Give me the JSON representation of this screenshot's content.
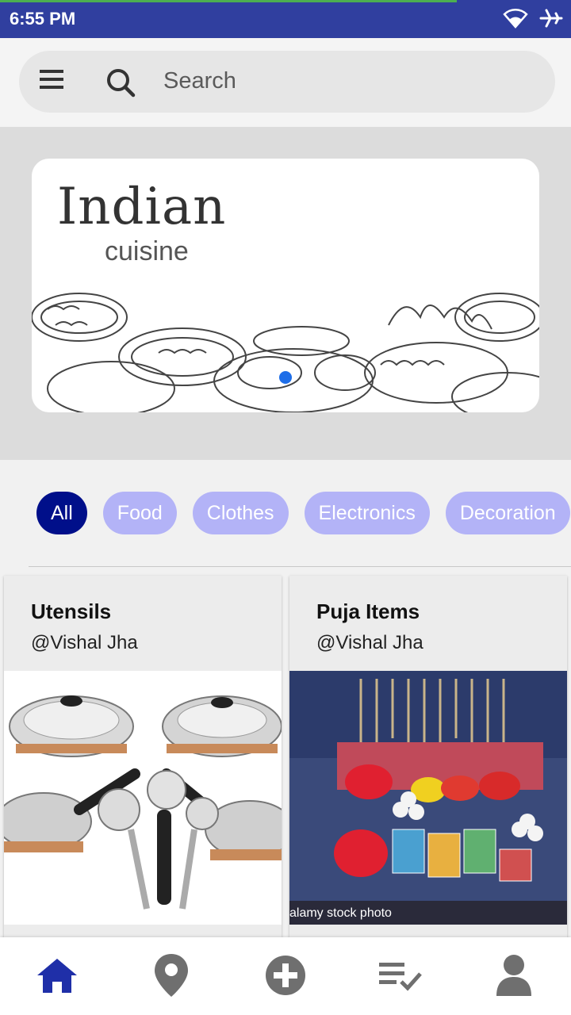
{
  "status_bar": {
    "time": "6:55 PM",
    "icons": [
      "wifi-icon",
      "airplane-icon"
    ],
    "color": "#303f9f"
  },
  "search": {
    "placeholder": "Search"
  },
  "banner": {
    "title": "Indian",
    "subtitle": "cuisine",
    "slide_count": 1,
    "active_slide": 1
  },
  "chips": [
    {
      "label": "All",
      "active": true
    },
    {
      "label": "Food",
      "active": false
    },
    {
      "label": "Clothes",
      "active": false
    },
    {
      "label": "Electronics",
      "active": false
    },
    {
      "label": "Decoration",
      "active": false
    }
  ],
  "cards": [
    {
      "title": "Utensils",
      "author": "@Vishal Jha"
    },
    {
      "title": "Puja Items",
      "author": "@Vishal Jha",
      "image_caption": "alamy stock photo"
    }
  ],
  "bottom_nav": [
    {
      "icon": "home-icon",
      "active": true
    },
    {
      "icon": "location-pin-icon",
      "active": false
    },
    {
      "icon": "add-circle-icon",
      "active": false
    },
    {
      "icon": "checklist-icon",
      "active": false
    },
    {
      "icon": "profile-icon",
      "active": false
    }
  ],
  "colors": {
    "accent": "#000f8a",
    "chip_inactive": "#b3b3f7",
    "nav_active": "#1f2fa8",
    "nav_inactive": "#6f6f6f"
  }
}
